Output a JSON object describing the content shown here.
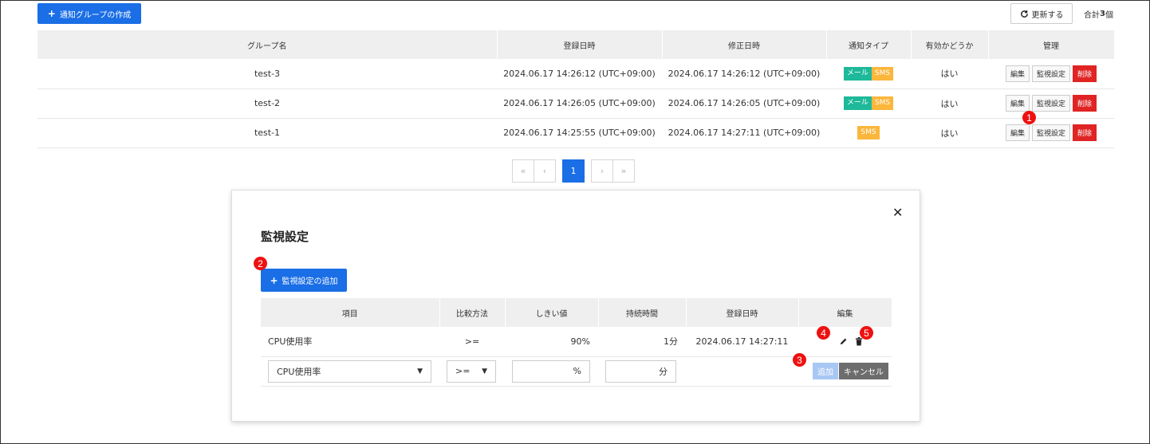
{
  "toolbar": {
    "create_label": "通知グループの作成",
    "refresh_label": "更新する",
    "total_prefix": "合計",
    "total_count": "3",
    "total_suffix": "個"
  },
  "main_table": {
    "headers": [
      "グループ名",
      "登録日時",
      "修正日時",
      "通知タイプ",
      "有効かどうか",
      "管理"
    ],
    "rows": [
      {
        "name": "test-3",
        "registered": "2024.06.17 14:26:12 (UTC+09:00)",
        "modified": "2024.06.17 14:26:12 (UTC+09:00)",
        "types": [
          "メール",
          "SMS"
        ],
        "enabled": "はい"
      },
      {
        "name": "test-2",
        "registered": "2024.06.17 14:26:05 (UTC+09:00)",
        "modified": "2024.06.17 14:26:05 (UTC+09:00)",
        "types": [
          "メール",
          "SMS"
        ],
        "enabled": "はい"
      },
      {
        "name": "test-1",
        "registered": "2024.06.17 14:25:55 (UTC+09:00)",
        "modified": "2024.06.17 14:27:11 (UTC+09:00)",
        "types": [
          "SMS"
        ],
        "enabled": "はい"
      }
    ],
    "actions": {
      "edit": "編集",
      "monitor": "監視設定",
      "delete": "削除"
    }
  },
  "pagination": {
    "first": "«",
    "prev": "‹",
    "current": "1",
    "next": "›",
    "last": "»"
  },
  "modal": {
    "title": "監視設定",
    "close": "✕",
    "add_label": "監視設定の追加",
    "headers": [
      "項目",
      "比較方法",
      "しきい値",
      "持続時間",
      "登録日時",
      "編集"
    ],
    "row": {
      "item": "CPU使用率",
      "compare": ">=",
      "threshold": "90%",
      "duration": "1分",
      "registered": "2024.06.17 14:27:11"
    },
    "form": {
      "item": "CPU使用率",
      "compare": ">=",
      "threshold_unit": "%",
      "duration_unit": "分",
      "add": "追加",
      "cancel": "キャンセル"
    }
  },
  "markers": [
    "1",
    "2",
    "3",
    "4",
    "5"
  ],
  "colors": {
    "primary": "#1a6ee6",
    "danger": "#e02424",
    "mail": "#1db99a",
    "sms": "#fbb63c",
    "marker": "#ee1111"
  }
}
